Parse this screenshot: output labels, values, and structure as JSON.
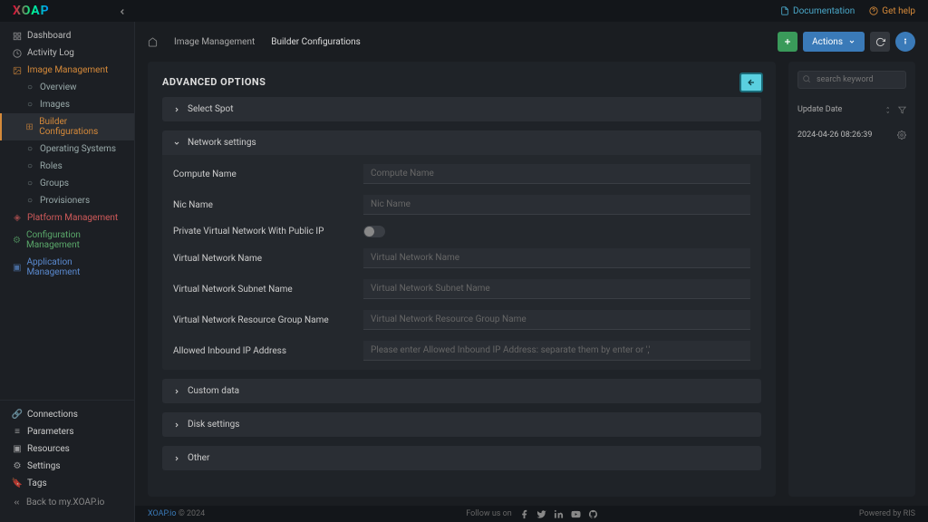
{
  "header": {
    "logo": "XOAP",
    "doc_link": "Documentation",
    "help_link": "Get help"
  },
  "sidebar": {
    "main": [
      {
        "icon": "dashboard",
        "label": "Dashboard"
      },
      {
        "icon": "activity",
        "label": "Activity Log"
      }
    ],
    "image_mgmt": {
      "label": "Image Management",
      "items": [
        {
          "label": "Overview"
        },
        {
          "label": "Images"
        },
        {
          "label": "Builder Configurations",
          "active": true
        },
        {
          "label": "Operating Systems"
        },
        {
          "label": "Roles"
        },
        {
          "label": "Groups"
        },
        {
          "label": "Provisioners"
        }
      ]
    },
    "other_sections": [
      {
        "label": "Platform Management",
        "cls": "red"
      },
      {
        "label": "Configuration Management",
        "cls": "green"
      },
      {
        "label": "Application Management",
        "cls": "blue"
      }
    ],
    "bottom": [
      {
        "icon": "link",
        "label": "Connections"
      },
      {
        "icon": "sliders",
        "label": "Parameters"
      },
      {
        "icon": "box",
        "label": "Resources"
      },
      {
        "icon": "gear",
        "label": "Settings"
      },
      {
        "icon": "tag",
        "label": "Tags"
      }
    ],
    "back": "Back to my.XOAP.io"
  },
  "breadcrumb": {
    "items": [
      "Image Management",
      "Builder Configurations"
    ]
  },
  "topbar": {
    "actions_label": "Actions"
  },
  "panel": {
    "title": "ADVANCED OPTIONS",
    "sections": {
      "spot": "Select Spot",
      "network": "Network settings",
      "custom": "Custom data",
      "disk": "Disk settings",
      "other": "Other"
    },
    "network": {
      "compute_name": {
        "label": "Compute Name",
        "ph": "Compute Name"
      },
      "nic_name": {
        "label": "Nic Name",
        "ph": "Nic Name"
      },
      "public_ip": {
        "label": "Private Virtual Network With Public IP"
      },
      "vnet_name": {
        "label": "Virtual Network Name",
        "ph": "Virtual Network Name"
      },
      "subnet": {
        "label": "Virtual Network Subnet Name",
        "ph": "Virtual Network Subnet Name"
      },
      "rg": {
        "label": "Virtual Network Resource Group Name",
        "ph": "Virtual Network Resource Group Name"
      },
      "inbound": {
        "label": "Allowed Inbound IP Address",
        "ph": "Please enter Allowed Inbound IP Address: separate them by enter or ','"
      }
    }
  },
  "side": {
    "search_ph": "search keyword",
    "col": "Update Date",
    "row_date": "2024-04-26 08:26:39"
  },
  "footer": {
    "brand": "XOAP.io",
    "copy": "© 2024",
    "follow": "Follow us on",
    "powered": "Powered by RIS"
  }
}
